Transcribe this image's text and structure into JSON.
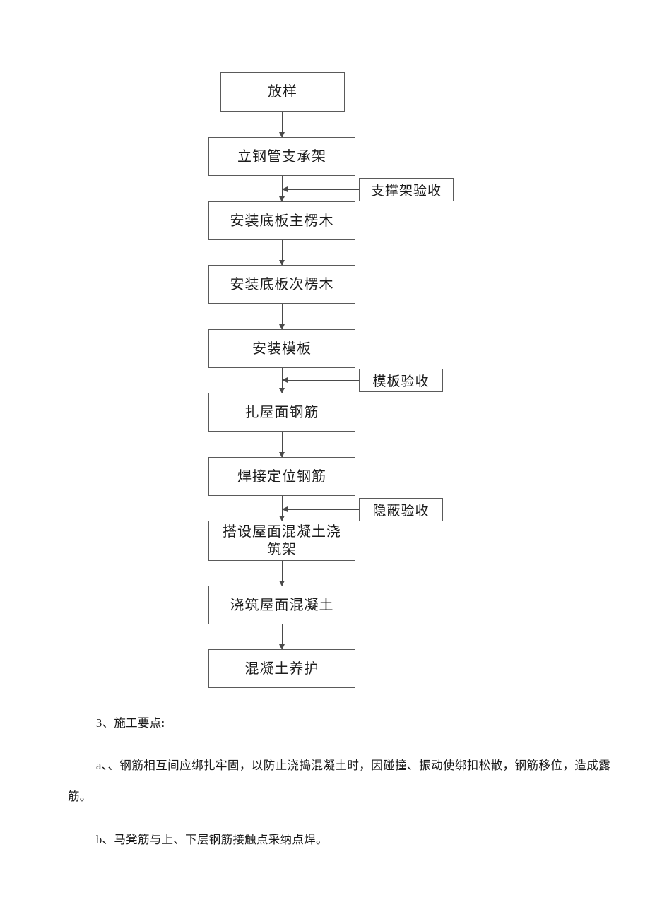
{
  "document": {
    "page_background": "#ffffff",
    "line_color": "#4a4a4a",
    "text_color": "#1a1a1a"
  },
  "flowchart": {
    "type": "process-flow",
    "orientation": "vertical",
    "nodes": [
      {
        "id": "n1",
        "label": "放样"
      },
      {
        "id": "n2",
        "label": "立钢管支承架"
      },
      {
        "id": "n3",
        "label": "安装底板主楞木"
      },
      {
        "id": "n4",
        "label": "安装底板次楞木"
      },
      {
        "id": "n5",
        "label": "安装模板"
      },
      {
        "id": "n6",
        "label": "扎屋面钢筋"
      },
      {
        "id": "n7",
        "label": "焊接定位钢筋"
      },
      {
        "id": "n8",
        "label": "搭设屋面混凝土浇筑架"
      },
      {
        "id": "n9",
        "label": "浇筑屋面混凝土"
      },
      {
        "id": "n10",
        "label": "混凝土养护"
      }
    ],
    "side_nodes": [
      {
        "id": "s1",
        "label": "支撑架验收",
        "attaches_between": [
          "n2",
          "n3"
        ]
      },
      {
        "id": "s2",
        "label": "模板验收",
        "attaches_between": [
          "n5",
          "n6"
        ]
      },
      {
        "id": "s3",
        "label": "隐蔽验收",
        "attaches_between": [
          "n7",
          "n8"
        ]
      }
    ]
  },
  "content": {
    "heading": "3、施工要点:",
    "item_a": "a、、钢筋相互间应绑扎牢固，以防止浇捣混凝土时，因碰撞、振动使绑扣松散，钢筋移位，造成露筋。",
    "item_b": "b、马凳筋与上、下层钢筋接触点采纳点焊。"
  }
}
